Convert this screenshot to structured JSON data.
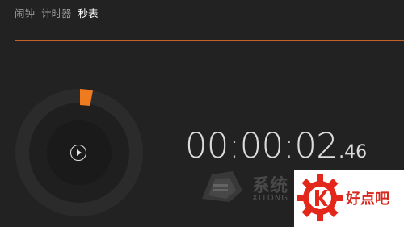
{
  "tabs": [
    {
      "label": "闹钟",
      "active": false
    },
    {
      "label": "计时器",
      "active": false
    },
    {
      "label": "秒表",
      "active": true
    }
  ],
  "stopwatch": {
    "hours": "00",
    "minutes": "00",
    "seconds": "02",
    "fraction": ".46",
    "separator": ":",
    "play_icon": "play-icon"
  },
  "colors": {
    "background": "#222222",
    "accent": "#f07a1e",
    "accent_line": "#c5622a",
    "ring": "#2b2b2b"
  },
  "watermarks": {
    "left": {
      "text_cn": "系统",
      "text_en": "XITONG"
    },
    "right": {
      "text": "好点吧",
      "icon": "k-gear-badge"
    }
  }
}
